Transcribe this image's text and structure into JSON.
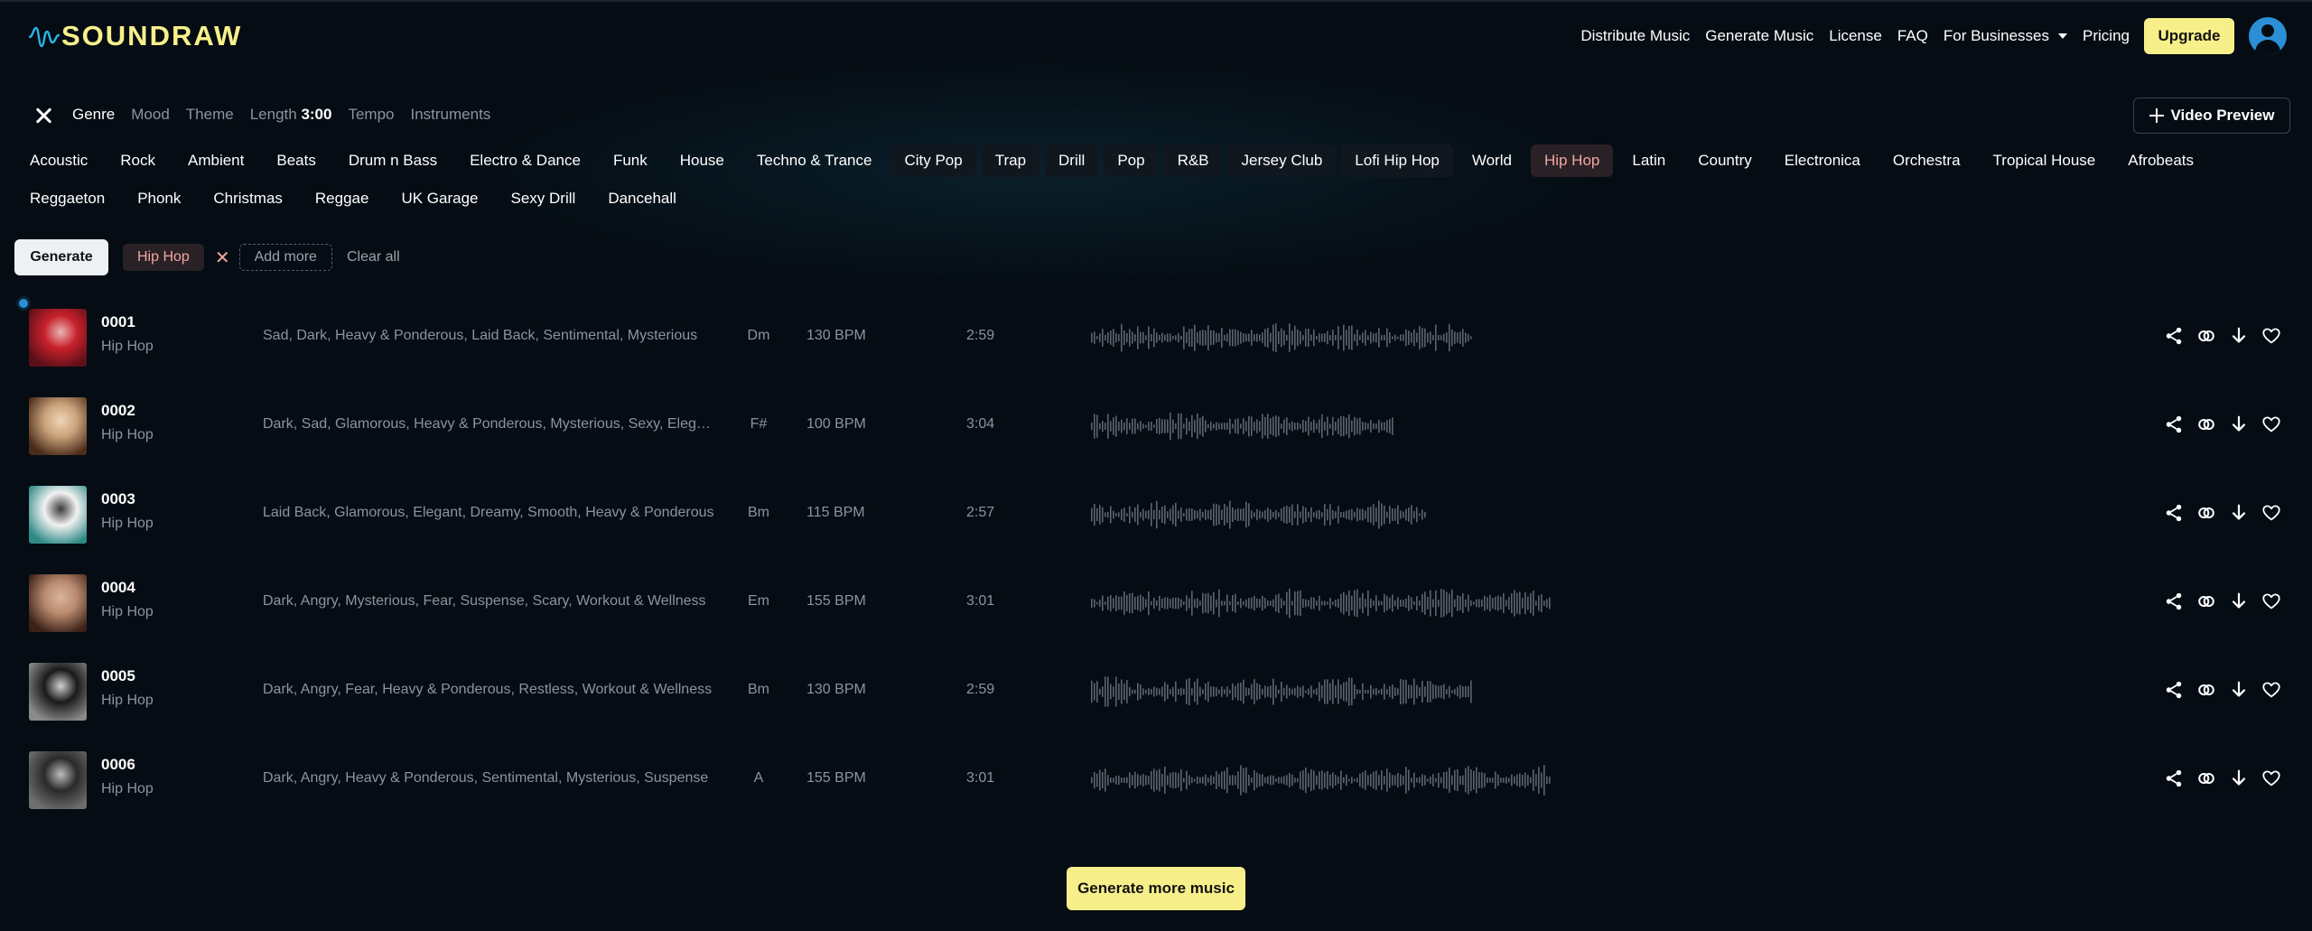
{
  "brand": {
    "name": "SOUNDRAW",
    "color": "#f7f08a"
  },
  "nav": {
    "links": [
      "Distribute Music",
      "Generate Music",
      "License",
      "FAQ"
    ],
    "for_businesses": "For Businesses",
    "pricing": "Pricing",
    "upgrade": "Upgrade"
  },
  "filters": {
    "tabs": {
      "genre": "Genre",
      "mood": "Mood",
      "theme": "Theme",
      "length_label": "Length",
      "length_value": "3:00",
      "tempo": "Tempo",
      "instruments": "Instruments"
    },
    "video_preview": "Video Preview"
  },
  "genres": [
    "Acoustic",
    "Rock",
    "Ambient",
    "Beats",
    "Drum n Bass",
    "Electro & Dance",
    "Funk",
    "House",
    "Techno & Trance",
    "City Pop",
    "Trap",
    "Drill",
    "Pop",
    "R&B",
    "Jersey Club",
    "Lofi Hip Hop",
    "World",
    "Hip Hop",
    "Latin",
    "Country",
    "Electronica",
    "Orchestra",
    "Tropical House",
    "Afrobeats",
    "Reggaeton",
    "Phonk",
    "Christmas",
    "Reggae",
    "UK Garage",
    "Sexy Drill",
    "Dancehall"
  ],
  "highlighted_genres": [
    "City Pop",
    "Trap",
    "Drill",
    "Pop",
    "R&B",
    "Jersey Club",
    "Lofi Hip Hop"
  ],
  "selected_genre": "Hip Hop",
  "generate": {
    "button": "Generate",
    "selected_tag": "Hip Hop",
    "remove_symbol": "✕",
    "add_more": "Add more",
    "clear_all": "Clear all"
  },
  "tracks": [
    {
      "title": "0001",
      "genre": "Hip Hop",
      "moods": "Sad, Dark, Heavy & Ponderous, Laid Back, Sentimental, Mysterious",
      "key": "Dm",
      "bpm": "130 BPM",
      "duration": "2:59",
      "wave_extent": 0.83,
      "thumb": [
        "#c8212b",
        "#5a0f18",
        "#e9b6b6"
      ]
    },
    {
      "title": "0002",
      "genre": "Hip Hop",
      "moods": "Dark, Sad, Glamorous, Heavy & Ponderous, Mysterious, Sexy, Elegant",
      "key": "F#",
      "bpm": "100 BPM",
      "duration": "3:04",
      "wave_extent": 0.66,
      "thumb": [
        "#c9a27a",
        "#4a2c1a",
        "#f0d6b8"
      ]
    },
    {
      "title": "0003",
      "genre": "Hip Hop",
      "moods": "Laid Back, Glamorous, Elegant, Dreamy, Smooth, Heavy & Ponderous",
      "key": "Bm",
      "bpm": "115 BPM",
      "duration": "2:57",
      "wave_extent": 0.73,
      "thumb": [
        "#f2f2f2",
        "#2f8a86",
        "#3a3a3a"
      ]
    },
    {
      "title": "0004",
      "genre": "Hip Hop",
      "moods": "Dark, Angry, Mysterious, Fear, Suspense, Scary, Workout & Wellness",
      "key": "Em",
      "bpm": "155 BPM",
      "duration": "3:01",
      "wave_extent": 1.0,
      "thumb": [
        "#b98a6e",
        "#3b2118",
        "#d9b59c"
      ]
    },
    {
      "title": "0005",
      "genre": "Hip Hop",
      "moods": "Dark, Angry, Fear, Heavy & Ponderous, Restless, Workout & Wellness",
      "key": "Bm",
      "bpm": "130 BPM",
      "duration": "2:59",
      "wave_extent": 0.83,
      "thumb": [
        "#1a1a1a",
        "#8a8a8a",
        "#d0d0d0"
      ]
    },
    {
      "title": "0006",
      "genre": "Hip Hop",
      "moods": "Dark, Angry, Heavy & Ponderous, Sentimental, Mysterious, Suspense",
      "key": "A",
      "bpm": "155 BPM",
      "duration": "3:01",
      "wave_extent": 1.0,
      "thumb": [
        "#2a2a2a",
        "#6e6e6e",
        "#bdbdbd"
      ]
    }
  ],
  "icons": {
    "share": "share-icon",
    "variation": "link-icon",
    "download": "download-icon",
    "favorite": "heart-icon"
  },
  "generate_more": "Generate more music",
  "colors": {
    "accent_yellow": "#f7f08a",
    "background": "#050c13",
    "selected_genre_bg": "#2a2126",
    "selected_genre_text": "#f0a7a0",
    "muted_text": "#8b949e",
    "avatar_blue": "#2b8fd6"
  }
}
